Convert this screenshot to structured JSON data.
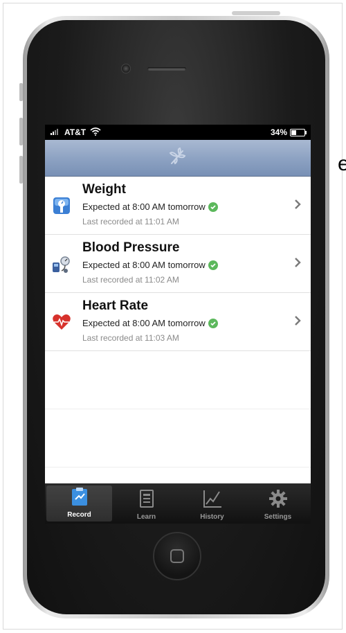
{
  "status_bar": {
    "carrier": "AT&T",
    "battery": "34%"
  },
  "list": {
    "rows": [
      {
        "title": "Weight",
        "expected": "Expected at 8:00 AM tomorrow",
        "last": "Last recorded at 11:01 AM",
        "icon": "scale-icon"
      },
      {
        "title": "Blood Pressure",
        "expected": "Expected at 8:00 AM tomorrow",
        "last": "Last recorded at 11:02 AM",
        "icon": "blood-pressure-icon"
      },
      {
        "title": "Heart Rate",
        "expected": "Expected at 8:00 AM tomorrow",
        "last": "Last recorded at 11:03 AM",
        "icon": "heart-icon"
      }
    ]
  },
  "tabs": [
    {
      "label": "Record",
      "icon": "clipboard-icon",
      "active": true
    },
    {
      "label": "Learn",
      "icon": "book-icon",
      "active": false
    },
    {
      "label": "History",
      "icon": "chart-icon",
      "active": false
    },
    {
      "label": "Settings",
      "icon": "gear-icon",
      "active": false
    }
  ],
  "colors": {
    "nav_bar": "#8ea3c3",
    "check": "#5cb85c",
    "tab_bar": "#111111"
  },
  "page_edge_text": "e"
}
